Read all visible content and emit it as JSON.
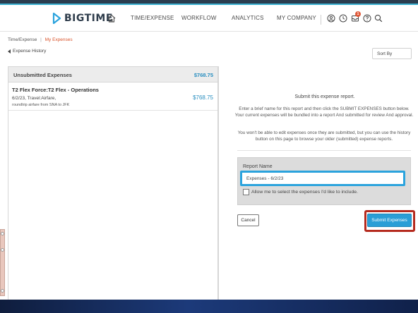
{
  "brand": {
    "name": "BIGTIME"
  },
  "nav": {
    "items": [
      "TIME/EXPENSE",
      "WORKFLOW",
      "ANALYTICS",
      "MY COMPANY"
    ],
    "notification_count": "1",
    "icons": [
      "home-icon",
      "user-icon",
      "clock-icon",
      "inbox-icon",
      "help-icon",
      "search-icon"
    ]
  },
  "breadcrumb": {
    "parent": "Time/Expense",
    "separator": "|",
    "current": "My Expenses"
  },
  "history_link": "Expense History",
  "sort": {
    "label": "Sort By"
  },
  "unsubmitted": {
    "title": "Unsubmitted Expenses",
    "total": "$768.75",
    "items": [
      {
        "name": "T2 Flex Force:T2 Flex - Operations",
        "detail": "6/2/23, Travel:Airfare,",
        "note": "roundtrip airfare from SNA to JFK",
        "amount": "$768.75"
      }
    ]
  },
  "submit_panel": {
    "heading": "Submit this expense report.",
    "instructions": "Enter a brief name for this report and then click the SUBMIT EXPENSES button below. Your current expenses will be bundled into a report And submitted for review And approval.",
    "warning": "You won't be able to edit expenses once they are submitted, but you can use the history button on this page to browse your older (submitted) expense reports.",
    "report_name_label": "Report Name",
    "report_name_value": "Expenses - 6/2/23",
    "select_option_label": "Allow me to select the expenses I'd like to include.",
    "cancel_label": "Cancel",
    "submit_label": "Submit Expenses"
  },
  "colors": {
    "accent": "#2a9ed6",
    "link": "#d9542c",
    "highlight": "#b52b1f",
    "money": "#2a8fc0"
  }
}
